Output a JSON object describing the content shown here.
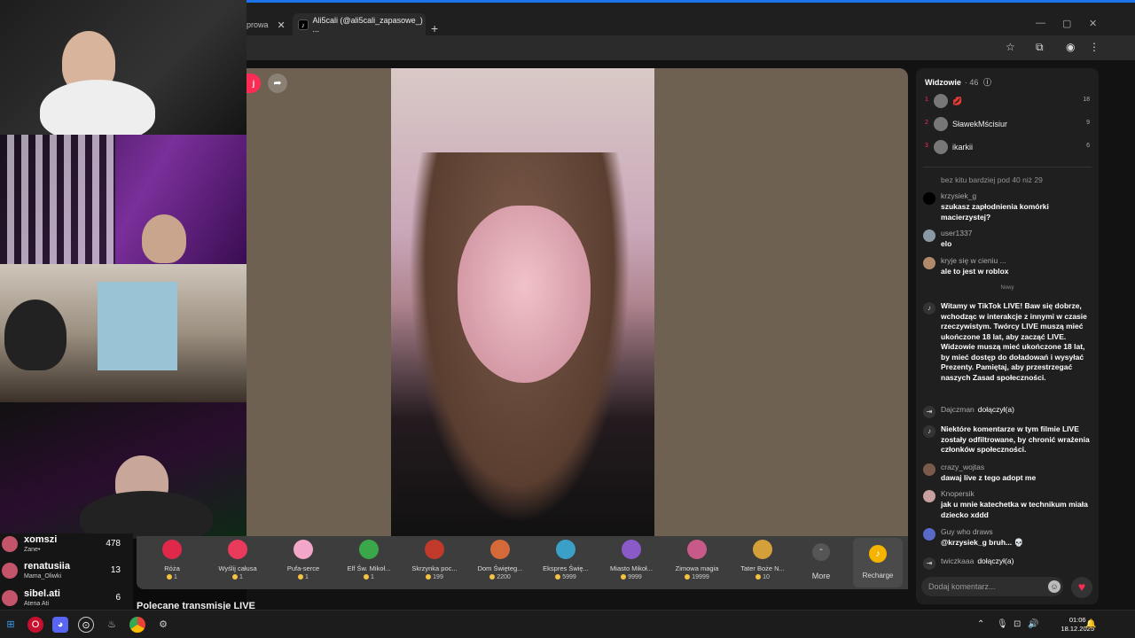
{
  "browser": {
    "tabs": [
      {
        "label": "prowa"
      },
      {
        "label": "Ali5cali (@ali5cali_zapasowe_) ..."
      }
    ],
    "new_tab": "+",
    "win_minimize": "—",
    "win_maximize": "▢",
    "win_close": "✕"
  },
  "player": {
    "follow_label": "j",
    "share_icon": "share-icon"
  },
  "gifts": [
    {
      "name": "Róża",
      "price": "1",
      "color": "#e0284a"
    },
    {
      "name": "Wyślij całusa",
      "price": "1",
      "color": "#e83a5a"
    },
    {
      "name": "Pufa-serce",
      "price": "1",
      "color": "#f2a6c8"
    },
    {
      "name": "Elf Św. Mikoł...",
      "price": "1",
      "color": "#3aa84a"
    },
    {
      "name": "Skrzynka poc...",
      "price": "199",
      "color": "#c0392b"
    },
    {
      "name": "Dom Święteg...",
      "price": "2200",
      "color": "#d46a3a"
    },
    {
      "name": "Ekspres Świę...",
      "price": "5999",
      "color": "#3aa0c8"
    },
    {
      "name": "Miasto Mikoł...",
      "price": "9999",
      "color": "#8a5ac8"
    },
    {
      "name": "Zimowa magia",
      "price": "19999",
      "color": "#c85a8a"
    },
    {
      "name": "Tater Boże N...",
      "price": "10",
      "color": "#d4a03a"
    }
  ],
  "more_label": "More",
  "recharge_label": "Recharge",
  "recommended_label": "Polecane transmisje LIVE",
  "donors": [
    {
      "name": "xomszi",
      "sub": "Zane•",
      "count": "478"
    },
    {
      "name": "renatusiia",
      "sub": "Mama_Oliwki",
      "count": "13"
    },
    {
      "name": "sibel.ati",
      "sub": "Atena Ati",
      "count": "6"
    }
  ],
  "sidebar": {
    "viewers_title": "Widzowie",
    "viewers_count": "· 46",
    "viewers": [
      {
        "rank": "1",
        "name": "",
        "score": "18"
      },
      {
        "rank": "2",
        "name": "SławekMścisiur",
        "score": "9"
      },
      {
        "rank": "3",
        "name": "ikarkii",
        "score": "6"
      }
    ],
    "messages": [
      {
        "name": "",
        "text": "bez kitu bardziej pod 40 niż 29"
      },
      {
        "name": "krzysiek_g",
        "text": "szukasz zapłodnienia komórki macierzystej?"
      },
      {
        "name": "user1337",
        "text": "elo"
      },
      {
        "name": "kryje się w cieniu ...",
        "text": "ale to jest w roblox"
      }
    ],
    "new_label": "Nowy",
    "system_welcome": "Witamy w TikTok LIVE! Baw się dobrze, wchodząc w interakcje z innymi w czasie rzeczywistym. Twórcy LIVE muszą mieć ukończone 18 lat, aby zacząć LIVE. Widzowie muszą mieć ukończone 18 lat, by mieć dostęp do doładowań i wysyłać Prezenty. Pamiętaj, aby przestrzegać naszych Zasad społeczności.",
    "join1_name": "Dajczman",
    "join_action": "dołączył(a)",
    "filter_notice": "Niektóre komentarze w tym filmie LIVE zostały odfiltrowane, by chronić wrażenia członków społeczności.",
    "messages2": [
      {
        "name": "crazy_wojtas",
        "text": "dawaj live z tego adopt me"
      },
      {
        "name": "Knopersik",
        "text": "jak u mnie katechetka w technikum miała dziecko xddd"
      },
      {
        "name": "Guy who draws",
        "text": "@krzysiek_g bruh... 💀"
      }
    ],
    "join2_name": "twiczkaaa",
    "comment_placeholder": "Dodaj komentarz...",
    "emoji_icon": "☺",
    "like_icon": "♥"
  },
  "taskbar": {
    "time": "01:06",
    "date": "18.12.2025"
  }
}
